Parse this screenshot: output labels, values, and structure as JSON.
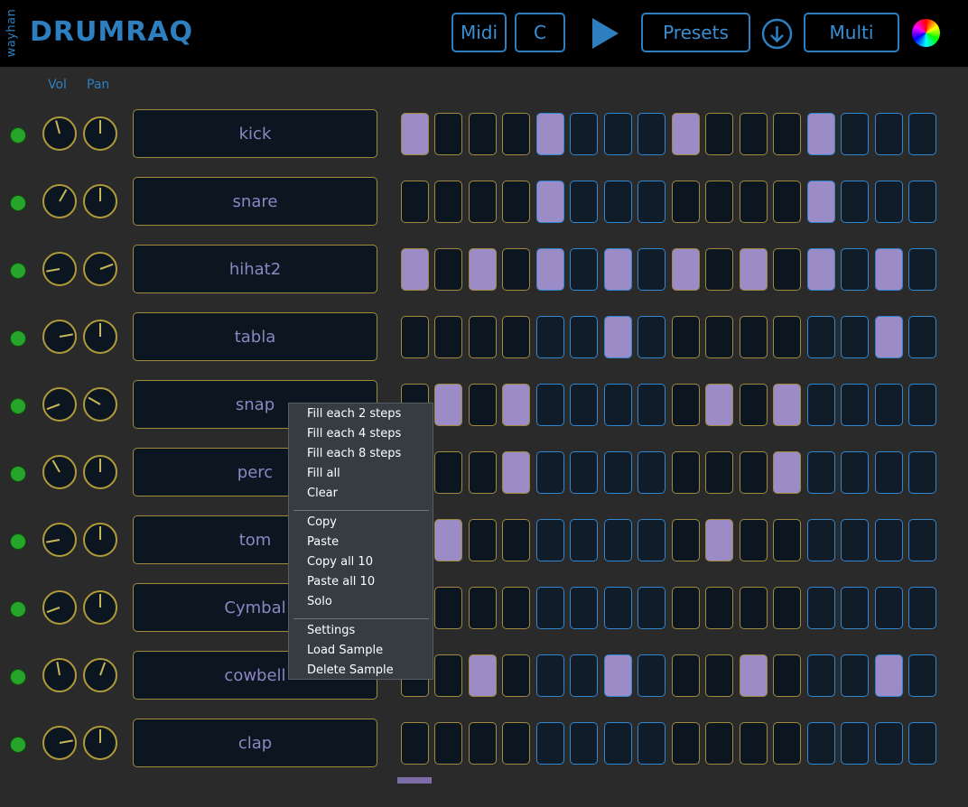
{
  "header": {
    "brand_small": "wayhan",
    "brand": "DRUMRAQ",
    "midi_label": "Midi",
    "key_label": "C",
    "presets_label": "Presets",
    "mode_label": "Multi"
  },
  "columns": {
    "vol": "Vol",
    "pan": "Pan"
  },
  "tracks": [
    {
      "name": "kick",
      "vol": -15,
      "pan": 0,
      "steps": [
        1,
        0,
        0,
        0,
        1,
        0,
        0,
        0,
        1,
        0,
        0,
        0,
        1,
        0,
        0,
        0
      ]
    },
    {
      "name": "snare",
      "vol": 30,
      "pan": 0,
      "steps": [
        0,
        0,
        0,
        0,
        1,
        0,
        0,
        0,
        0,
        0,
        0,
        0,
        1,
        0,
        0,
        0
      ]
    },
    {
      "name": "hihat2",
      "vol": -100,
      "pan": 70,
      "steps": [
        1,
        0,
        1,
        0,
        1,
        0,
        1,
        0,
        1,
        0,
        1,
        0,
        1,
        0,
        1,
        0
      ]
    },
    {
      "name": "tabla",
      "vol": 80,
      "pan": 0,
      "steps": [
        0,
        0,
        0,
        0,
        0,
        0,
        1,
        0,
        0,
        0,
        0,
        0,
        0,
        0,
        1,
        0
      ]
    },
    {
      "name": "snap",
      "vol": -110,
      "pan": -60,
      "steps": [
        0,
        1,
        0,
        1,
        0,
        0,
        0,
        0,
        0,
        1,
        0,
        1,
        0,
        0,
        0,
        0
      ]
    },
    {
      "name": "perc",
      "vol": -30,
      "pan": 0,
      "steps": [
        0,
        0,
        0,
        1,
        0,
        0,
        0,
        0,
        0,
        0,
        0,
        1,
        0,
        0,
        0,
        0
      ]
    },
    {
      "name": "tom",
      "vol": -100,
      "pan": 0,
      "steps": [
        0,
        1,
        0,
        0,
        0,
        0,
        0,
        0,
        0,
        1,
        0,
        0,
        0,
        0,
        0,
        0
      ]
    },
    {
      "name": "Cymbal",
      "vol": -110,
      "pan": 0,
      "steps": [
        0,
        0,
        0,
        0,
        0,
        0,
        0,
        0,
        0,
        0,
        0,
        0,
        0,
        0,
        0,
        0
      ]
    },
    {
      "name": "cowbell",
      "vol": -10,
      "pan": 20,
      "steps": [
        0,
        0,
        1,
        0,
        0,
        0,
        1,
        0,
        0,
        0,
        1,
        0,
        0,
        0,
        1,
        0
      ]
    },
    {
      "name": "clap",
      "vol": 80,
      "pan": 0,
      "steps": [
        0,
        0,
        0,
        0,
        0,
        0,
        0,
        0,
        0,
        0,
        0,
        0,
        0,
        0,
        0,
        0
      ]
    }
  ],
  "context_menu": {
    "groups": [
      [
        "Fill each 2 steps",
        "Fill each 4 steps",
        "Fill each 8 steps",
        "Fill all",
        "Clear"
      ],
      [
        "Copy",
        "Paste",
        "Copy all 10",
        "Paste all 10",
        "Solo"
      ],
      [
        "Settings",
        "Load Sample",
        "Delete Sample"
      ]
    ]
  },
  "colors": {
    "accent": "#2d7fc0",
    "step_on": "#9b8cc8",
    "gold": "#a08a3e",
    "led": "#27a52a"
  }
}
